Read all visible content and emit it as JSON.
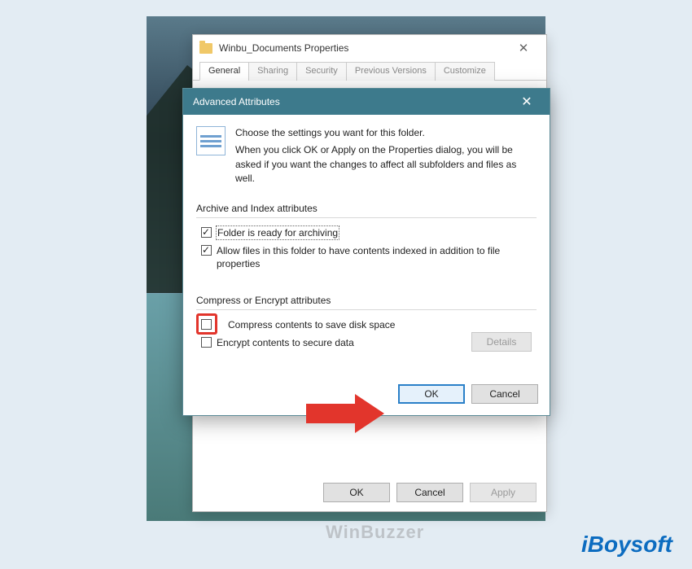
{
  "properties": {
    "title": "Winbu_Documents Properties",
    "tabs": [
      "General",
      "Sharing",
      "Security",
      "Previous Versions",
      "Customize"
    ],
    "footer": {
      "ok": "OK",
      "cancel": "Cancel",
      "apply": "Apply"
    }
  },
  "advanced": {
    "title": "Advanced Attributes",
    "intro_line1": "Choose the settings you want for this folder.",
    "intro_line2": "When you click OK or Apply on the Properties dialog, you will be asked if you want the changes to affect all subfolders and files as well.",
    "groups": {
      "archive": {
        "label": "Archive and Index attributes",
        "items": [
          {
            "label": "Folder is ready for archiving",
            "checked": true,
            "focused": true
          },
          {
            "label": "Allow files in this folder to have contents indexed in addition to file properties",
            "checked": true
          }
        ]
      },
      "compress": {
        "label": "Compress or Encrypt attributes",
        "items": [
          {
            "label": "Compress contents to save disk space",
            "checked": false,
            "highlighted": true
          },
          {
            "label": "Encrypt contents to secure data",
            "checked": false
          }
        ],
        "details_button": "Details"
      }
    },
    "footer": {
      "ok": "OK",
      "cancel": "Cancel"
    }
  },
  "watermarks": {
    "brand": "iBoysoft",
    "bg": "WinBuzzer"
  }
}
